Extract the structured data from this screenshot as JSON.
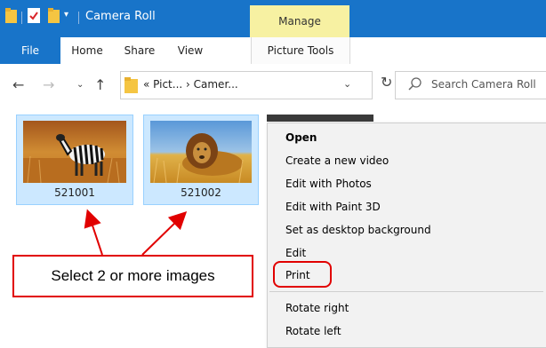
{
  "window": {
    "title": "Camera Roll",
    "manage_label": "Manage"
  },
  "ribbon": {
    "tabs": [
      "File",
      "Home",
      "Share",
      "View"
    ],
    "picture_tools": "Picture Tools"
  },
  "nav": {
    "breadcrumb": "« Pict...  ›  Camer...",
    "search_placeholder": "Search Camera Roll"
  },
  "thumbnails": [
    {
      "label": "521001",
      "icon": "zebra-photo"
    },
    {
      "label": "521002",
      "icon": "lion-photo"
    }
  ],
  "context_menu": {
    "items": [
      "Open",
      "Create a new video",
      "Edit with Photos",
      "Edit with Paint 3D",
      "Set as desktop background",
      "Edit",
      "Print",
      "Rotate right",
      "Rotate left"
    ]
  },
  "annotation": {
    "text": "Select 2 or more images",
    "color": "#e10000"
  },
  "colors": {
    "accent": "#1874c9",
    "selection": "#cce8ff",
    "manage": "#f7f1a2"
  }
}
